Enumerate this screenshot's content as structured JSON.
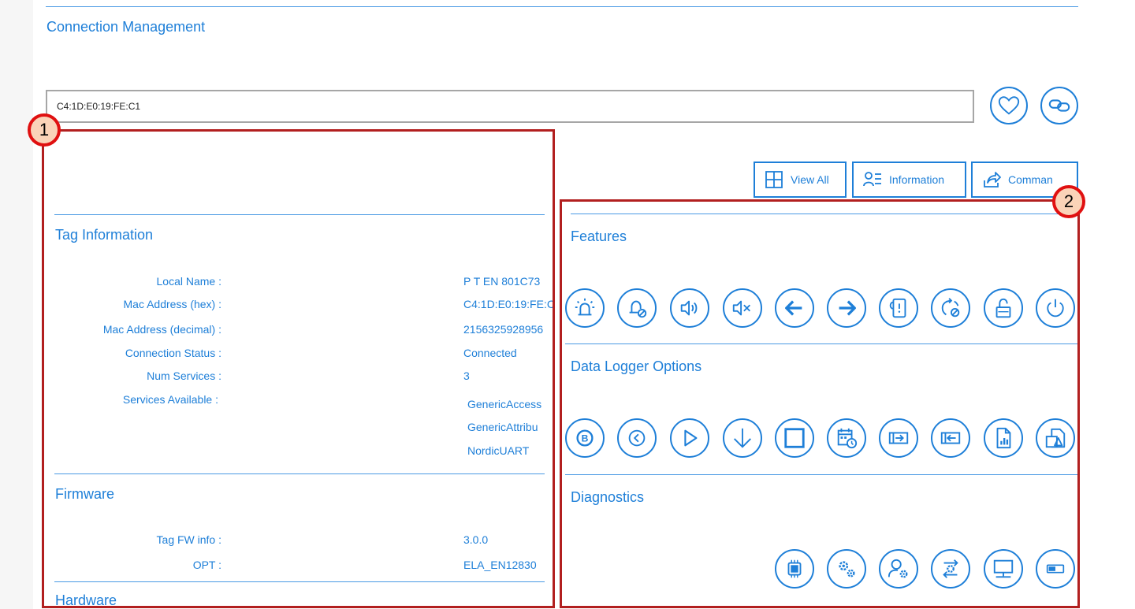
{
  "connection": {
    "title": "Connection Management",
    "address_value": "C4:1D:E0:19:FE:C1",
    "favorite_icon": "heart-icon",
    "link_icon": "link-icon"
  },
  "toolbar": {
    "view_all_label": "View All",
    "information_label": "Information",
    "commands_label": "Comman"
  },
  "tag_info": {
    "title": "Tag Information",
    "rows": [
      {
        "label": "Local Name :",
        "value": "P T EN 801C73"
      },
      {
        "label": "Mac Address (hex) :",
        "value": "C4:1D:E0:19:FE:C"
      },
      {
        "label": "Mac Address (decimal) :",
        "value": "2156325928956"
      },
      {
        "label": "Connection Status :",
        "value": "Connected"
      },
      {
        "label": "Num Services :",
        "value": "3"
      },
      {
        "label": "Services Available :",
        "value": ""
      }
    ],
    "services": [
      "GenericAccess",
      "GenericAttribu",
      "NordicUART"
    ]
  },
  "firmware": {
    "title": "Firmware",
    "rows": [
      {
        "label": "Tag FW info :",
        "value": "3.0.0"
      },
      {
        "label": "OPT :",
        "value": "ELA_EN12830"
      }
    ]
  },
  "hardware": {
    "title": "Hardware"
  },
  "features": {
    "title": "Features",
    "icons": [
      "alarm-light-icon",
      "bell-off-icon",
      "volume-on-icon",
      "volume-mute-icon",
      "arrow-left-icon",
      "arrow-right-icon",
      "phone-alert-icon",
      "refresh-off-icon",
      "lock-open-icon",
      "power-icon"
    ]
  },
  "data_logger": {
    "title": "Data Logger Options",
    "icons": [
      "b-circle-icon",
      "chevron-back-icon",
      "play-icon",
      "download-arrow-icon",
      "stop-square-icon",
      "calendar-clock-icon",
      "import-icon",
      "export-icon",
      "document-chart-icon",
      "file-image-icon"
    ]
  },
  "diagnostics": {
    "title": "Diagnostics",
    "icons": [
      "chip-icon",
      "gears-icon",
      "user-settings-icon",
      "sync-settings-icon",
      "monitor-icon",
      "battery-icon"
    ]
  },
  "annotations": {
    "badge_1": "1",
    "badge_2": "2"
  },
  "colors": {
    "accent": "#1e7fd8",
    "annotation": "#b21f1f",
    "badge_fill": "#fad3b8",
    "badge_ring": "#e01010"
  }
}
